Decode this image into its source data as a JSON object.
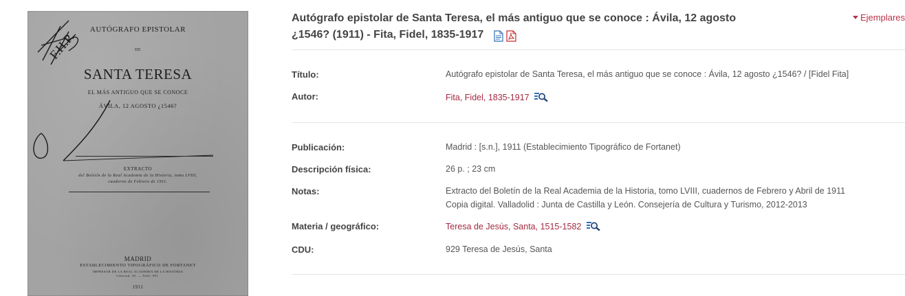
{
  "cover": {
    "line1": "AUTÓGRAFO EPISTOLAR",
    "line2": "DE",
    "line3": "SANTA TERESA",
    "line4": "EL MÁS ANTIGUO QUE SE CONOCE",
    "line5": "ÁVILA, 12 AGOSTO ¿1546?",
    "extract_title": "EXTRACTO",
    "extract_line1": "del Boletín de la Real Academia de la Historia, tomo LVIII,",
    "extract_line2": "cuaderno de Febrero de 1911.",
    "city": "MADRID",
    "printer": "ESTABLECIMIENTO TIPOGRÁFICO DE FORTANET",
    "printer_sub1": "IMPRESOR DE LA REAL ACADEMIA DE LA HISTORIA",
    "printer_sub2": "Libertad, 29. — Teléf. 991.",
    "year": "1911",
    "handwriting": "F.H.P."
  },
  "header": {
    "title_line1": "Autógrafo epistolar de Santa Teresa, el más antiguo que se conoce : Ávila, 12 agosto",
    "title_line2": "¿1546? (1911) - Fita, Fidel, 1835-1917",
    "ejemplares_label": "Ejemplares",
    "icons": [
      "document-icon",
      "pdf-icon"
    ]
  },
  "fields": {
    "titulo": {
      "label": "Título:",
      "value": "Autógrafo epistolar de Santa Teresa, el más antiguo que se conoce : Ávila, 12 agosto ¿1546? / [Fidel Fita]"
    },
    "autor": {
      "label": "Autor:",
      "value": "Fita, Fidel, 1835-1917"
    },
    "publicacion": {
      "label": "Publicación:",
      "value": "Madrid : [s.n.], 1911 (Establecimiento Tipográfico de Fortanet)"
    },
    "descripcion": {
      "label": "Descripción física:",
      "value": "26 p. ; 23 cm"
    },
    "notas": {
      "label": "Notas:",
      "value1": "Extracto del Boletín de la Real Academia de la Historia, tomo LVIII, cuadernos de Febrero y Abril de 1911",
      "value2": "Copia digital. Valladolid : Junta de Castilla y León. Consejería de Cultura y Turismo, 2012-2013"
    },
    "materia": {
      "label": "Materia / geográfico:",
      "value": "Teresa de Jesús, Santa, 1515-1582"
    },
    "cdu": {
      "label": "CDU:",
      "value": "929 Teresa de Jesús, Santa"
    }
  },
  "colors": {
    "link": "#a32a40",
    "accent": "#b83347",
    "label": "#444444",
    "value": "#555555",
    "divider": "#e5e5e5"
  }
}
